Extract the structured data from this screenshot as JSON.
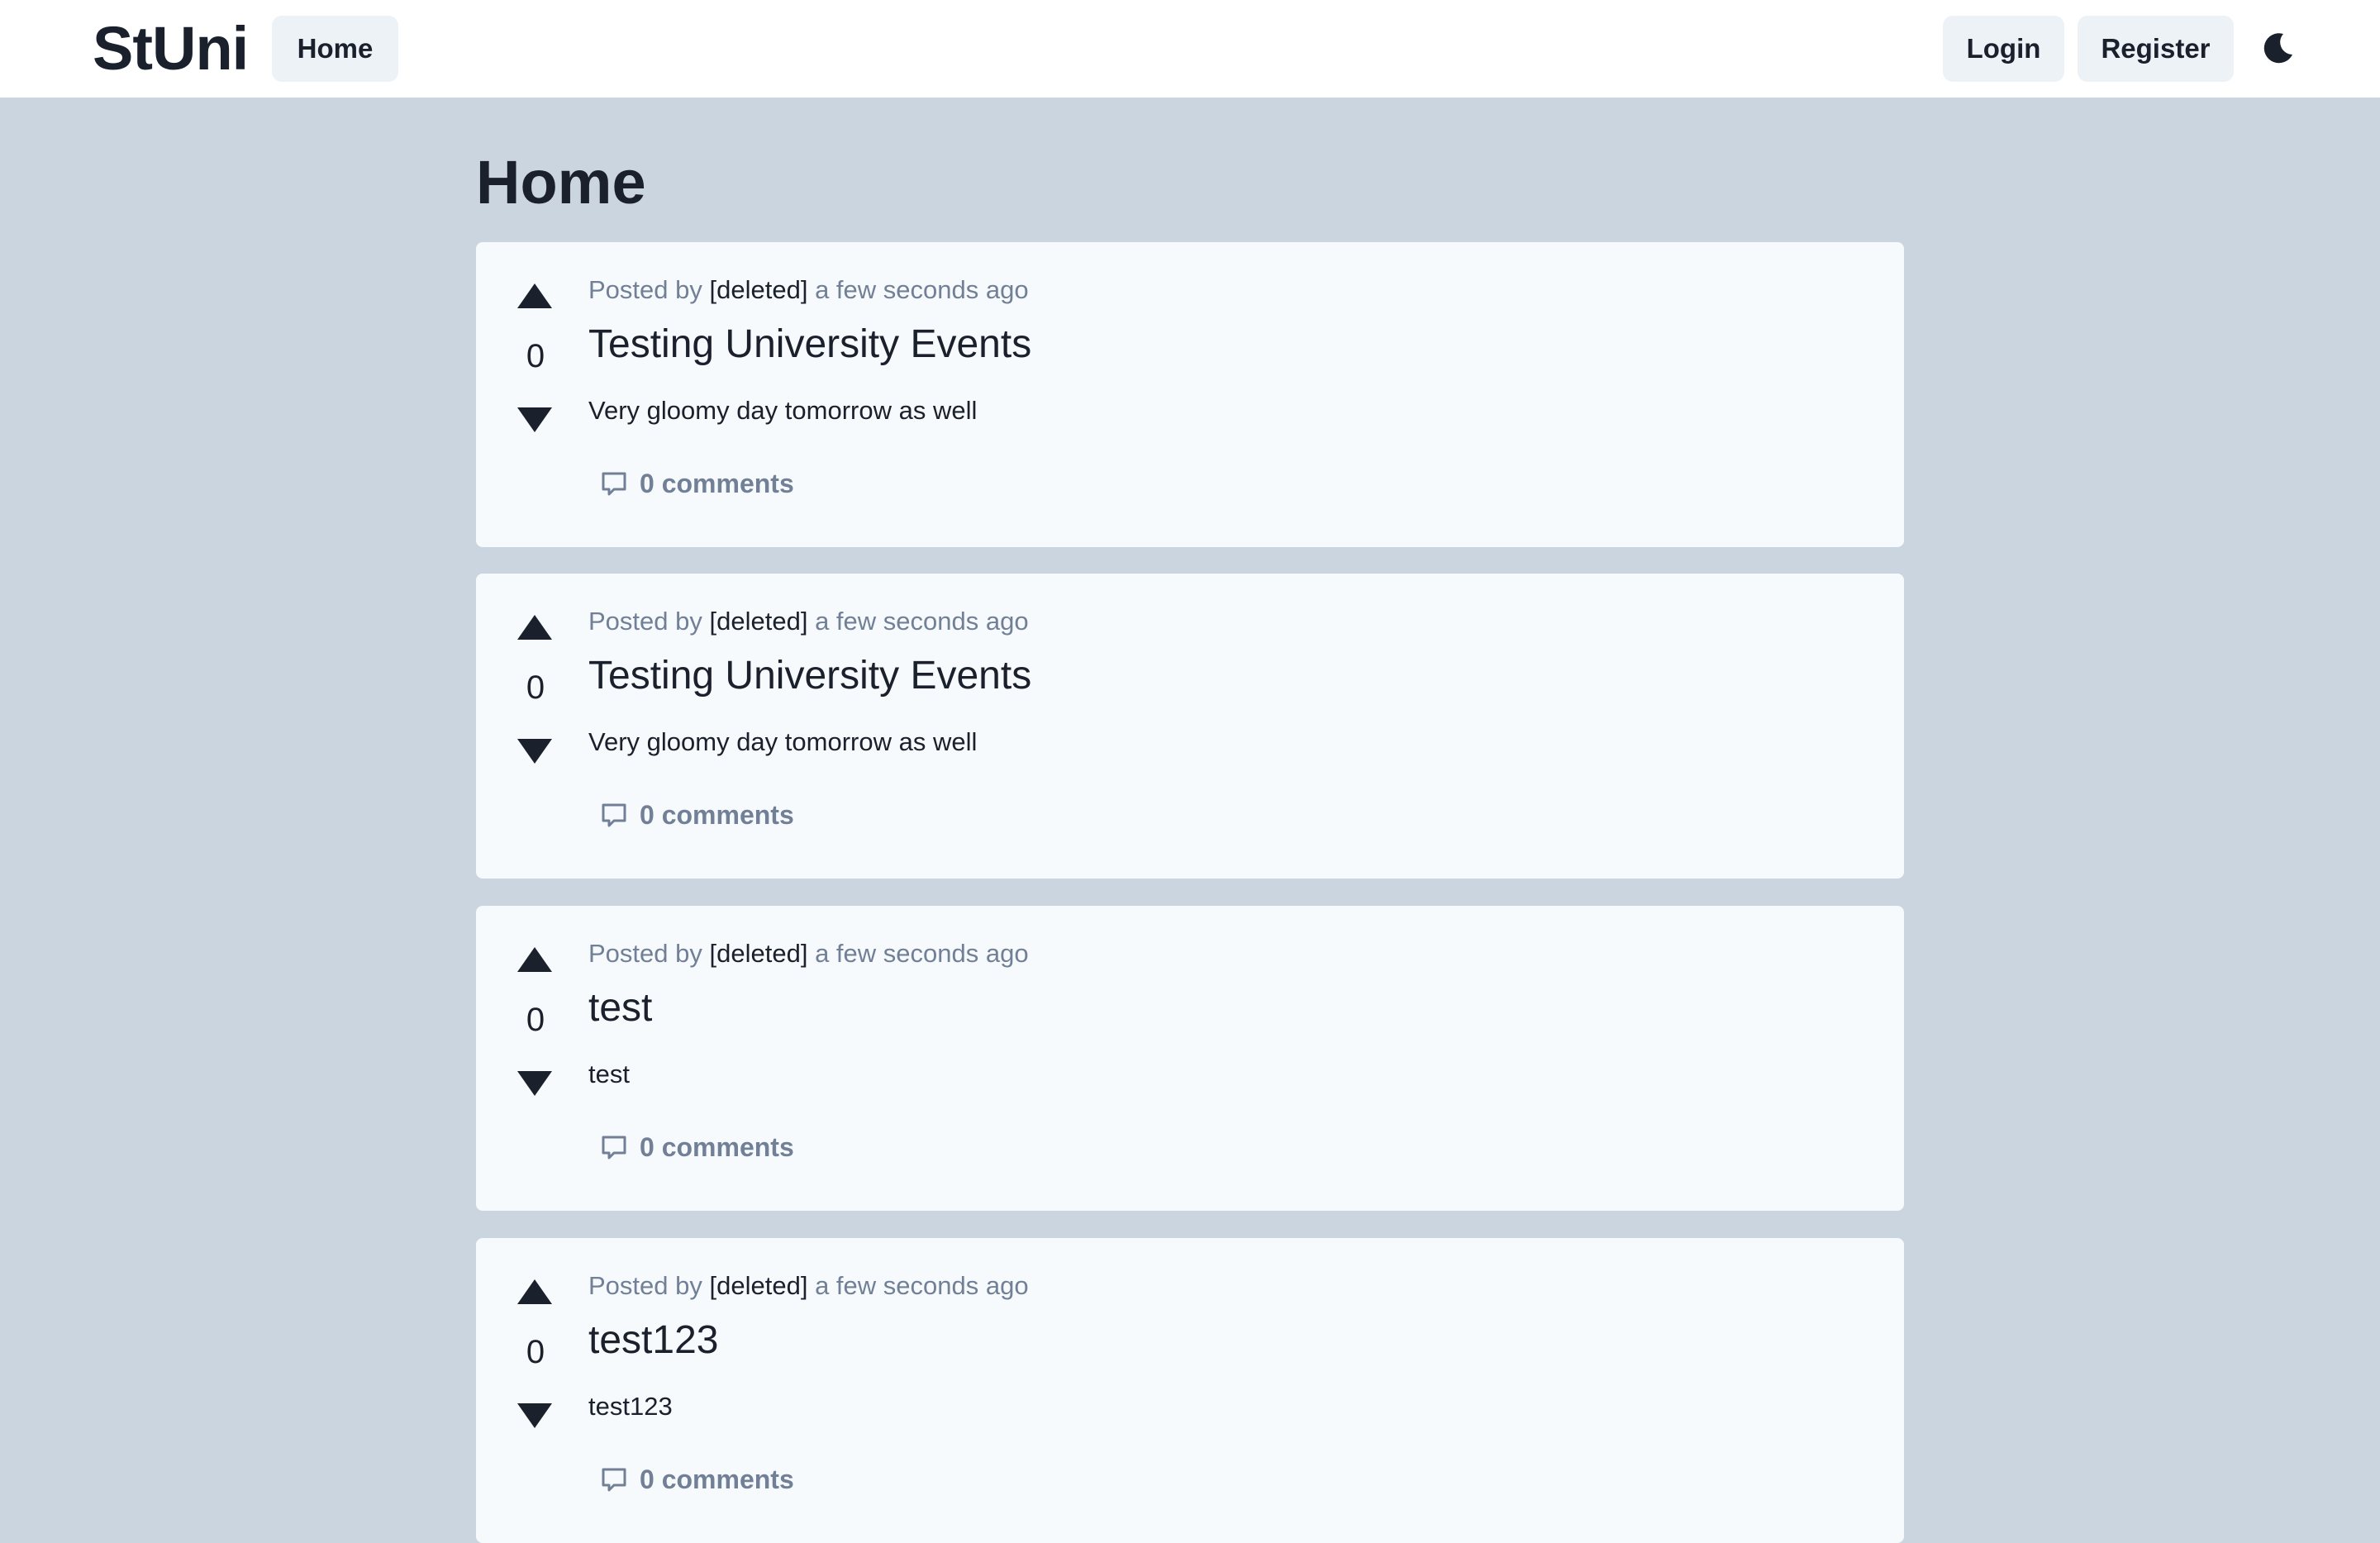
{
  "navbar": {
    "brand": "StUni",
    "home_label": "Home",
    "login_label": "Login",
    "register_label": "Register",
    "theme_toggle_icon": "moon-icon"
  },
  "page": {
    "title": "Home"
  },
  "posts": [
    {
      "votes": "0",
      "posted_by_prefix": "Posted by",
      "author": "[deleted]",
      "time": "a few seconds ago",
      "title": "Testing University Events",
      "body": "Very gloomy day tomorrow as well",
      "comments": "0 comments"
    },
    {
      "votes": "0",
      "posted_by_prefix": "Posted by",
      "author": "[deleted]",
      "time": "a few seconds ago",
      "title": "Testing University Events",
      "body": "Very gloomy day tomorrow as well",
      "comments": "0 comments"
    },
    {
      "votes": "0",
      "posted_by_prefix": "Posted by",
      "author": "[deleted]",
      "time": "a few seconds ago",
      "title": "test",
      "body": "test",
      "comments": "0 comments"
    },
    {
      "votes": "0",
      "posted_by_prefix": "Posted by",
      "author": "[deleted]",
      "time": "a few seconds ago",
      "title": "test123",
      "body": "test123",
      "comments": "0 comments"
    }
  ],
  "icons": {
    "upvote": "arrow-up-icon",
    "downvote": "arrow-down-icon",
    "comment": "comment-icon"
  }
}
